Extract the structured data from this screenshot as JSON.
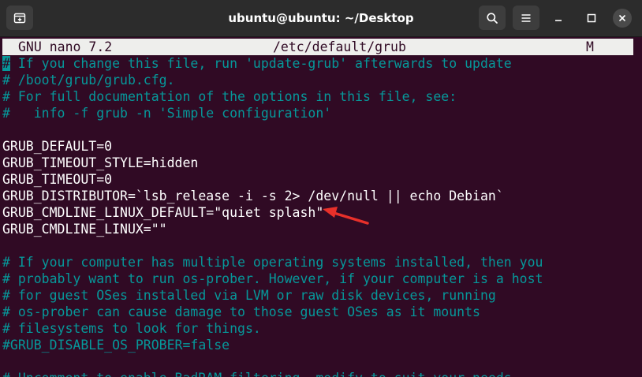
{
  "window": {
    "title": "ubuntu@ubuntu: ~/Desktop"
  },
  "nano": {
    "version": "GNU nano 7.2",
    "filename": "/etc/default/grub",
    "modified_flag": "M"
  },
  "lines": [
    {
      "text": " If you change this file, run 'update-grub' afterwards to update",
      "prefix": "#",
      "type": "comment"
    },
    {
      "text": "# /boot/grub/grub.cfg.",
      "type": "comment"
    },
    {
      "text": "# For full documentation of the options in this file, see:",
      "type": "comment"
    },
    {
      "text": "#   info -f grub -n 'Simple configuration'",
      "type": "comment"
    },
    {
      "text": "",
      "type": "plain"
    },
    {
      "text": "GRUB_DEFAULT=0",
      "type": "plain"
    },
    {
      "text": "GRUB_TIMEOUT_STYLE=hidden",
      "type": "plain"
    },
    {
      "text": "GRUB_TIMEOUT=0",
      "type": "plain"
    },
    {
      "text": "GRUB_DISTRIBUTOR=`lsb_release -i -s 2> /dev/null || echo Debian`",
      "type": "plain"
    },
    {
      "text": "GRUB_CMDLINE_LINUX_DEFAULT=\"quiet splash\"",
      "type": "plain"
    },
    {
      "text": "GRUB_CMDLINE_LINUX=\"\"",
      "type": "plain"
    },
    {
      "text": "",
      "type": "plain"
    },
    {
      "text": "# If your computer has multiple operating systems installed, then you",
      "type": "comment"
    },
    {
      "text": "# probably want to run os-prober. However, if your computer is a host",
      "type": "comment"
    },
    {
      "text": "# for guest OSes installed via LVM or raw disk devices, running",
      "type": "comment"
    },
    {
      "text": "# os-prober can cause damage to those guest OSes as it mounts",
      "type": "comment"
    },
    {
      "text": "# filesystems to look for things.",
      "type": "comment"
    },
    {
      "text": "#GRUB_DISABLE_OS_PROBER=false",
      "type": "comment"
    },
    {
      "text": "",
      "type": "plain"
    },
    {
      "text": "# Uncomment to enable BadRAM filtering, modify to suit your needs",
      "type": "comment"
    }
  ],
  "colors": {
    "terminal_bg": "#300a24",
    "comment": "#06989a",
    "text": "#ffffff",
    "annotation_arrow": "#e8302a"
  },
  "icons": {
    "new_tab": "new-tab-icon",
    "search": "search-icon",
    "menu": "hamburger-menu-icon",
    "minimize": "minimize-icon",
    "maximize": "maximize-icon",
    "close": "close-icon",
    "annotation": "red-arrow-icon"
  }
}
